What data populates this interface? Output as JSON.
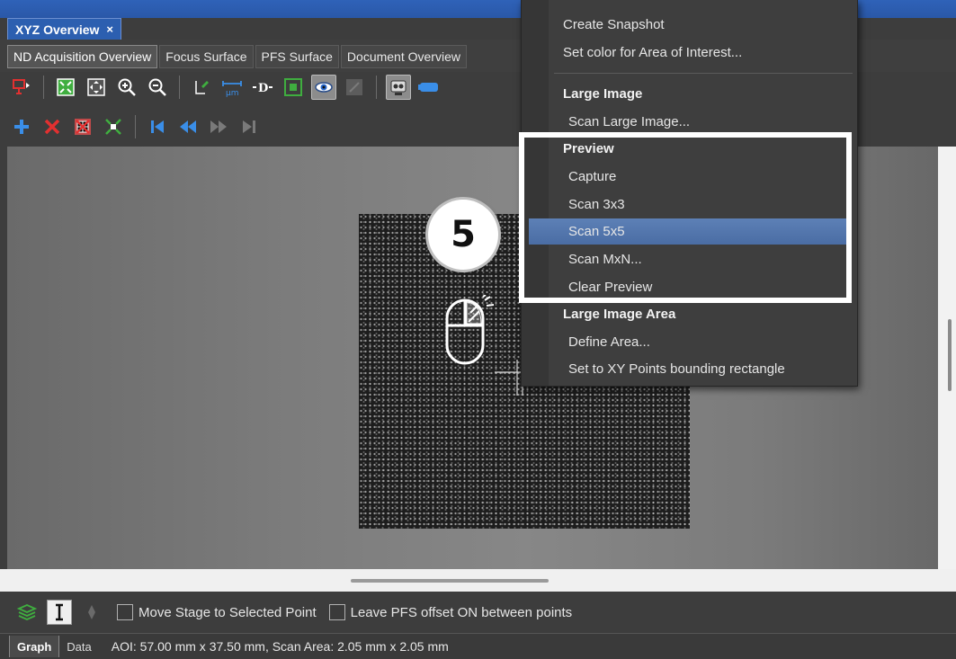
{
  "window": {
    "panel_title": "XYZ Overview",
    "close_glyph": "×"
  },
  "subtabs": [
    {
      "label": "ND Acquisition Overview",
      "active": true
    },
    {
      "label": "Focus Surface",
      "active": false
    },
    {
      "label": "PFS Surface",
      "active": false
    },
    {
      "label": "Document Overview",
      "active": false
    }
  ],
  "toolbar1_icons": [
    "stage-position-icon",
    "fit-image-icon",
    "pan-icon",
    "zoom-in-icon",
    "zoom-out-icon",
    "draw-line-icon",
    "scale-bar-icon",
    "distance-icon",
    "area-icon",
    "eye-icon",
    "overlay-icon",
    "camera-robot-icon",
    "objective-icon"
  ],
  "toolbar2_icons": [
    "add-point-icon",
    "delete-point-icon",
    "delete-all-icon",
    "collapse-icon",
    "first-point-icon",
    "previous-point-icon",
    "next-point-icon",
    "last-point-icon"
  ],
  "step_badge": "5",
  "context_menu": {
    "items": {
      "create_snapshot": "Create Snapshot",
      "set_color": "Set color for Area of Interest...",
      "large_image_head": "Large Image",
      "scan_large_image": "Scan Large Image...",
      "preview_head": "Preview",
      "capture": "Capture",
      "scan_3x3": "Scan 3x3",
      "scan_5x5": "Scan 5x5",
      "scan_mxn": "Scan MxN...",
      "clear_preview": "Clear Preview",
      "large_image_area_head": "Large Image Area",
      "define_area": "Define Area...",
      "set_xy_bounding": "Set to XY Points bounding rectangle"
    },
    "highlighted_item": "Scan 5x5"
  },
  "controls": {
    "move_stage_label": "Move Stage to Selected Point",
    "leave_pfs_label": "Leave PFS offset ON between points",
    "move_stage_checked": false,
    "leave_pfs_checked": false
  },
  "status": {
    "tab_graph": "Graph",
    "tab_data": "Data",
    "text": "AOI: 57.00 mm x 37.50 mm, Scan Area: 2.05 mm x 2.05 mm"
  },
  "colors": {
    "title_blue": "#2c5fb0",
    "menu_highlight": "#5377ae",
    "accent_green": "#3fae3f",
    "accent_red": "#e23030",
    "accent_blue": "#3a8ee8"
  }
}
